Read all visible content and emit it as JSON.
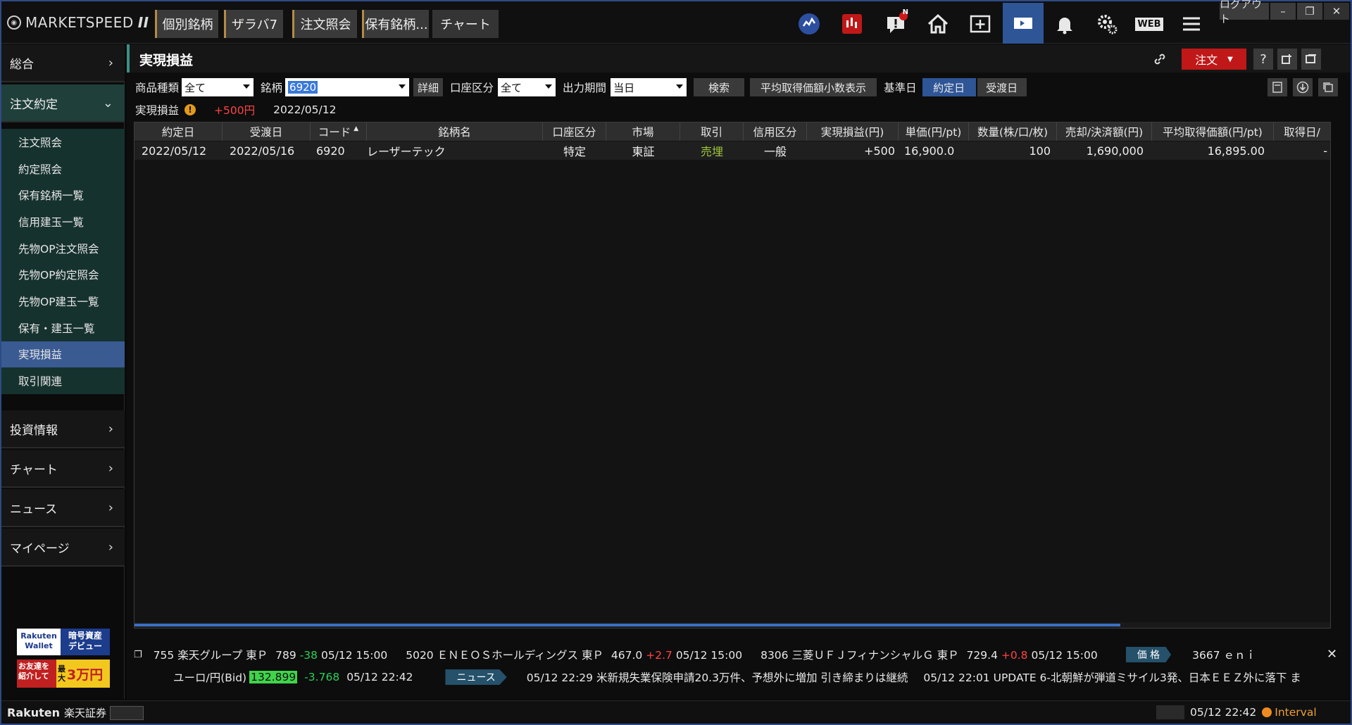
{
  "app": {
    "brand": "MARKETSPEED",
    "brand_suffix": "II"
  },
  "top_tabs": [
    "個別銘柄",
    "ザラバ7",
    "注文照会",
    "保有銘柄...",
    "チャート"
  ],
  "window": {
    "logout": "ログアウト",
    "minimize": "–",
    "restore": "❐",
    "close": "✕"
  },
  "top_icons": {
    "badge": "N",
    "web": "WEB"
  },
  "sidebar": {
    "sections": [
      "総合",
      "注文約定",
      "投資情報",
      "チャート",
      "ニュース",
      "マイページ"
    ],
    "sub_items": [
      "注文照会",
      "約定照会",
      "保有銘柄一覧",
      "信用建玉一覧",
      "先物OP注文照会",
      "先物OP約定照会",
      "先物OP建玉一覧",
      "保有・建玉一覧",
      "実現損益",
      "取引関連"
    ],
    "promo1": {
      "brand": "Rakuten",
      "wallet": "Wallet",
      "text1": "暗号資産",
      "text2": "デビュー"
    },
    "promo2": {
      "line1": "お友達を",
      "line2": "紹介して",
      "max1": "最",
      "max2": "大",
      "amount": "3万円"
    }
  },
  "panel": {
    "title": "実現損益",
    "order_button": "注文",
    "help": "?"
  },
  "filters": {
    "product_label": "商品種類",
    "product_value": "全て",
    "symbol_label": "銘柄",
    "symbol_value": "6920",
    "detail_button": "詳細",
    "account_label": "口座区分",
    "account_value": "全て",
    "period_label": "出力期間",
    "period_value": "当日",
    "search_button": "検索",
    "avg_button": "平均取得価額小数表示",
    "basedate_label": "基準日",
    "trade_date_button": "約定日",
    "settle_date_button": "受渡日"
  },
  "summary": {
    "label": "実現損益",
    "value": "+500円",
    "date": "2022/05/12"
  },
  "table": {
    "columns": [
      "約定日",
      "受渡日",
      "コード",
      "銘柄名",
      "口座区分",
      "市場",
      "取引",
      "信用区分",
      "実現損益(円)",
      "単価(円/pt)",
      "数量(株/口/枚)",
      "売却/決済額(円)",
      "平均取得価額(円/pt)",
      "取得日/"
    ],
    "rows": [
      {
        "trade_date": "2022/05/12",
        "settle_date": "2022/05/16",
        "code": "6920",
        "name": "レーザーテック",
        "account": "特定",
        "market": "東証",
        "trade": "売埋",
        "margin": "一般",
        "pnl": "+500",
        "price": "16,900.0",
        "qty": "100",
        "amount": "1,690,000",
        "avg_cost": "16,895.00",
        "acq": "-"
      }
    ]
  },
  "ticker": {
    "line1": [
      {
        "code": "755",
        "name": "楽天グループ",
        "mkt": "東Ｐ",
        "price": "789",
        "chg": "-38",
        "time": "05/12 15:00"
      },
      {
        "code": "5020",
        "name": "ＥＮＥＯＳホールディングス",
        "mkt": "東Ｐ",
        "price": "467.0",
        "chg": "+2.7",
        "time": "05/12 15:00"
      },
      {
        "code": "8306",
        "name": "三菱ＵＦＪフィナンシャルＧ",
        "mkt": "東Ｐ",
        "price": "729.4",
        "chg": "+0.8",
        "time": "05/12 15:00"
      }
    ],
    "price_tag": "価 格",
    "line1_tail": "3667 ｅｎｉ",
    "fx_label": "ユーロ/円(Bid)",
    "fx_value": "132.899",
    "fx_chg": "-3.768",
    "fx_time": "05/12 22:42",
    "news_tag": "ニュース",
    "news1": "05/12 22:29  米新規失業保険申請20.3万件、予想外に増加  引き締まりは継続",
    "news2": "05/12 22:01  UPDATE 6-北朝鮮が弾道ミサイル3発、日本ＥＥＺ外に落下  ま"
  },
  "status": {
    "brand": "Rakuten",
    "brand_jp": "楽天証券",
    "datetime": "05/12 22:42",
    "interval": "Interval"
  }
}
